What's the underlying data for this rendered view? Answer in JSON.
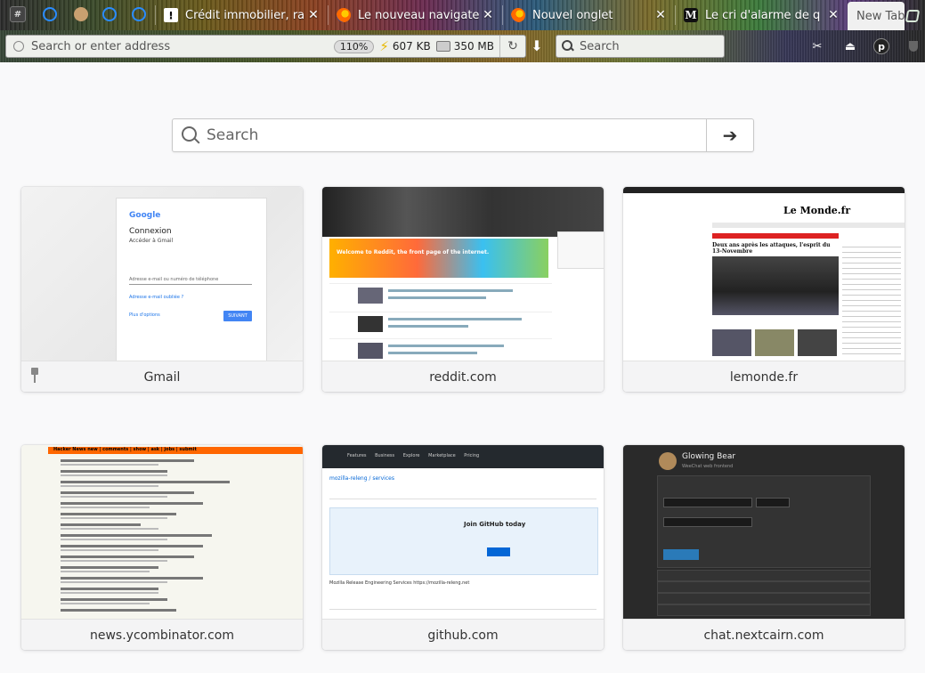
{
  "browser": {
    "pinned_tabs": [
      {
        "icon": "hash-icon",
        "glyph": "#"
      },
      {
        "icon": "blue-ring-icon",
        "glyph": ""
      },
      {
        "icon": "face-icon",
        "glyph": ""
      },
      {
        "icon": "blue-ring-icon",
        "glyph": ""
      },
      {
        "icon": "blue-ring-icon",
        "glyph": ""
      }
    ],
    "tabs": [
      {
        "title": "Crédit immobilier, ra",
        "icon": "exclamation-icon",
        "glyph": "!",
        "close": "✕",
        "active": false
      },
      {
        "title": "Le nouveau navigate",
        "icon": "firefox-icon",
        "glyph": "",
        "close": "✕",
        "active": false
      },
      {
        "title": "Nouvel onglet",
        "icon": "firefox-icon",
        "glyph": "",
        "close": "✕",
        "active": false
      },
      {
        "title": "Le cri d'alarme de q",
        "icon": "lemonde-icon",
        "glyph": "M",
        "close": "✕",
        "active": false
      },
      {
        "title": "New Tab",
        "icon": "",
        "glyph": "",
        "close": "",
        "active": true
      }
    ],
    "urlbar": {
      "placeholder": "Search or enter address",
      "zoom": "110%",
      "memory": "607 KB",
      "disk": "350 MB"
    },
    "searchbar": {
      "placeholder": "Search"
    }
  },
  "page": {
    "search": {
      "placeholder": "Search",
      "go_glyph": "➔"
    },
    "tiles": [
      {
        "label": "Gmail",
        "pinned": true
      },
      {
        "label": "reddit.com",
        "pinned": false
      },
      {
        "label": "lemonde.fr",
        "pinned": false
      },
      {
        "label": "news.ycombinator.com",
        "pinned": false
      },
      {
        "label": "github.com",
        "pinned": false
      },
      {
        "label": "chat.nextcairn.com",
        "pinned": false
      }
    ],
    "thumbs": {
      "gmail": {
        "logo": "Google",
        "heading": "Connexion",
        "sub": "Accéder à Gmail",
        "field": "Adresse e-mail ou numéro de téléphone",
        "forgot": "Adresse e-mail oubliée ?",
        "more": "Plus d'options",
        "next": "SUIVANT"
      },
      "reddit": {
        "banner": "Welcome to Reddit, the front page of the internet."
      },
      "lemonde": {
        "logo": "Le Monde.fr",
        "headline": "Deux ans après les attaques, l'esprit du 13-Novembre"
      },
      "hn": {
        "bar": "Hacker News new | comments | show | ask | jobs | submit"
      },
      "github": {
        "nav": "Features Business Explore Marketplace Pricing",
        "repo": "mozilla-releng / services",
        "join": "Join GitHub today",
        "desc": "Mozilla Release Engineering Services https://mozilla-releng.net"
      },
      "glowingbear": {
        "title": "Glowing Bear",
        "sub": "WeeChat web frontend",
        "host": "chat.nextcairn.com",
        "port": "5001",
        "password": "Password",
        "connect": "Connect ›"
      }
    }
  }
}
